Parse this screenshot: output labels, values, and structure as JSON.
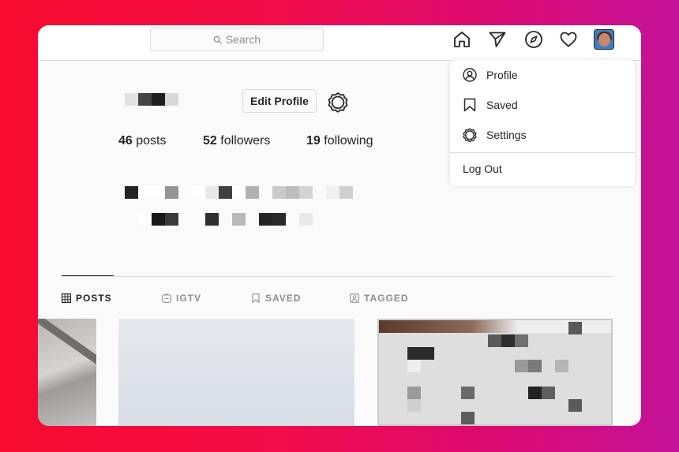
{
  "header": {
    "search_placeholder": "Search",
    "icons": [
      "home-icon",
      "direct-icon",
      "explore-icon",
      "activity-icon",
      "avatar"
    ]
  },
  "profile": {
    "edit_button": "Edit Profile",
    "stats": [
      {
        "count": "46",
        "label": "posts"
      },
      {
        "count": "52",
        "label": "followers"
      },
      {
        "count": "19",
        "label": "following"
      }
    ]
  },
  "tabs": [
    {
      "label": "POSTS",
      "icon": "grid-icon",
      "active": true
    },
    {
      "label": "IGTV",
      "icon": "igtv-icon",
      "active": false
    },
    {
      "label": "SAVED",
      "icon": "bookmark-icon",
      "active": false
    },
    {
      "label": "TAGGED",
      "icon": "tagged-icon",
      "active": false
    }
  ],
  "menu": {
    "items": [
      {
        "label": "Profile",
        "icon": "profile-icon"
      },
      {
        "label": "Saved",
        "icon": "bookmark-icon"
      },
      {
        "label": "Settings",
        "icon": "gear-icon"
      }
    ],
    "logout": "Log Out"
  },
  "colors": {
    "background_gradient_start": "#f70b2f",
    "background_gradient_end": "#c4139a",
    "text": "#262626",
    "muted": "#8e8e8e",
    "border": "#dbdbdb"
  }
}
